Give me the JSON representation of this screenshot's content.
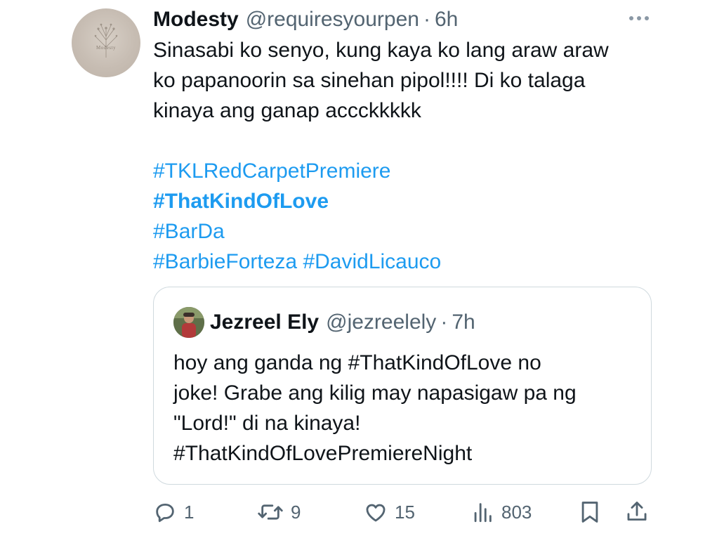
{
  "tweet": {
    "author_name": "Modesty",
    "author_handle": "@requiresyourpen",
    "separator": "·",
    "time": "6h",
    "avatar_text": "Modesty",
    "text_lines": [
      "Sinasabi ko senyo, kung kaya ko lang araw araw",
      "ko papanoorin sa sinehan pipol!!!! Di ko talaga",
      "kinaya ang ganap accckkkkk"
    ],
    "hashtags": {
      "line1": "#TKLRedCarpetPremiere",
      "line2": "#ThatKindOfLove",
      "line3": "#BarDa",
      "line4a": "#BarbieForteza",
      "line4b": "#DavidLicauco"
    }
  },
  "quoted_tweet": {
    "author_name": "Jezreel Ely",
    "author_handle": "@jezreelely",
    "separator": "·",
    "time": "7h",
    "lines": {
      "l1_pre": "hoy ang ganda ng ",
      "l1_tag": "#ThatKindOfLove",
      "l1_post": " no",
      "l2": "joke! Grabe ang kilig may napasigaw pa ng",
      "l3": "\"Lord!\" di na kinaya!",
      "l4": "#ThatKindOfLovePremiereNight"
    }
  },
  "actions": {
    "reply_count": "1",
    "retweet_count": "9",
    "like_count": "15",
    "view_count": "803",
    "icons": [
      "reply-icon",
      "retweet-icon",
      "like-icon",
      "views-icon",
      "bookmark-icon",
      "share-icon",
      "more-icon"
    ]
  },
  "colors": {
    "text": "#0f1419",
    "secondary": "#536471",
    "link": "#1d9bf0",
    "border": "#cfd9de"
  }
}
